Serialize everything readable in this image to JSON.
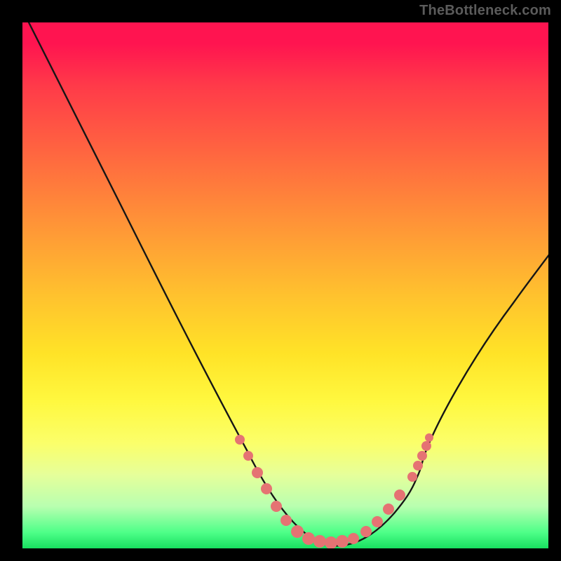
{
  "watermark": "TheBottleneck.com",
  "colors": {
    "background": "#000000",
    "curve": "#161616",
    "dot": "#e57373",
    "gradient_stops": [
      "#ff1450",
      "#ff3a49",
      "#ff6a3f",
      "#ff9a36",
      "#ffc22e",
      "#ffe327",
      "#fff83f",
      "#fbff6a",
      "#e6ff9a",
      "#b9ffb0",
      "#4dff88",
      "#18e060"
    ]
  },
  "chart_data": {
    "type": "line",
    "title": "",
    "xlabel": "",
    "ylabel": "",
    "xlim": [
      0,
      100
    ],
    "ylim": [
      0,
      100
    ],
    "note": "values read from vertical position (0 = bottom/green, 100 = top/red). Curve is a bottleneck V reaching ~0 around x≈55–63.",
    "series": [
      {
        "name": "bottleneck-curve",
        "x": [
          0,
          4,
          8,
          12,
          16,
          20,
          24,
          28,
          32,
          36,
          40,
          44,
          48,
          52,
          56,
          60,
          64,
          68,
          72,
          76,
          80,
          84,
          88,
          92,
          96,
          100
        ],
        "y": [
          100,
          94,
          87,
          80,
          73,
          66,
          59,
          52,
          45,
          38,
          31,
          23,
          15,
          7,
          1,
          0,
          1,
          5,
          11,
          18,
          25,
          32,
          39,
          46,
          52,
          58
        ]
      }
    ],
    "highlight_dots": {
      "name": "near-bottom-cluster",
      "note": "points clustered near the valley bottom (bottleneck ≈ 0–8%)",
      "x": [
        40,
        42,
        44,
        46,
        48,
        50,
        52,
        54,
        56,
        58,
        60,
        62,
        64,
        66,
        68,
        70,
        72,
        73,
        74
      ],
      "y": [
        22,
        18,
        14,
        10,
        6,
        3,
        2,
        1,
        1,
        0,
        0,
        0,
        1,
        2,
        4,
        7,
        11,
        14,
        18
      ]
    }
  }
}
